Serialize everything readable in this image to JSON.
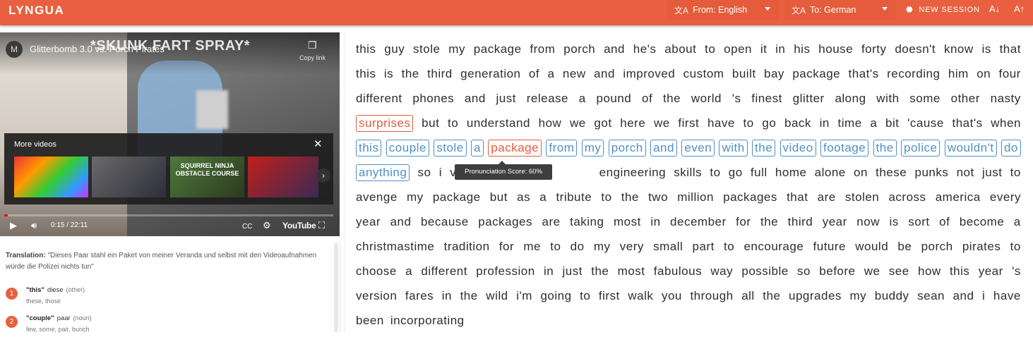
{
  "app": {
    "title": "LYNGUA"
  },
  "header": {
    "from_label": "From: English",
    "to_label": "To: German",
    "new_session_label": "NEW SESSION",
    "font_down_label": "A↓",
    "font_up_label": "A↑",
    "accent_color": "#e8603f"
  },
  "video": {
    "title": "Glitterbomb 3.0 vs. Porch Pirates",
    "overlay_text": "*SKUNK FART SPRAY*",
    "copy_link_label": "Copy link",
    "more_videos_label": "More videos",
    "thumb3_caption": "SQUIRREL NINJA OBSTACLE COURSE",
    "time": "0:15 / 22:11",
    "progress": 0.011,
    "youtube_label": "YouTube"
  },
  "translation_panel": {
    "label": "Translation:",
    "text": "\"Dieses Paar stahl ein Paket von meiner Veranda und selbst mit den Videoaufnahmen würde die Polizei nichts tun\"",
    "words": [
      {
        "num": "1",
        "en": "\"this\"",
        "de": "diese",
        "pos": "(other)",
        "alts": "these, those"
      },
      {
        "num": "2",
        "en": "\"couple\"",
        "de": "paar",
        "pos": "(noun)",
        "alts": "few, some, pair, bunch"
      }
    ]
  },
  "tooltip": {
    "text": "Pronunciation Score: 60%"
  },
  "transcript": {
    "lines": [
      [
        "this",
        "guy",
        "stole",
        "my",
        "package",
        "from",
        "porch",
        "and",
        "he's",
        "about",
        "to",
        "open",
        "it",
        "in",
        "his",
        "house",
        "forty",
        "doesn't",
        "know",
        "is",
        "that"
      ],
      [
        "this",
        "is",
        "the",
        "third",
        "generation",
        "of",
        "a",
        "new",
        "and",
        "improved",
        "custom",
        "built",
        "bay",
        "package",
        "that's",
        "recording",
        "him",
        "on",
        "four"
      ],
      [
        "different",
        "phones",
        "and",
        "just",
        "release",
        "a",
        "pound",
        "of",
        "the",
        "world",
        "'s",
        "finest",
        "glitter",
        "along",
        "with",
        "some",
        "other",
        "nasty"
      ],
      [
        "surprises",
        "but",
        "to",
        "understand",
        "how",
        "we",
        "got",
        "here",
        "we",
        "first",
        "have",
        "to",
        "go",
        "back",
        "in",
        "time",
        "a",
        "bit",
        "'cause",
        "that's",
        "when"
      ],
      [
        "this",
        "couple",
        "stole",
        "a",
        "package",
        "from",
        "my",
        "porch",
        "and",
        "even",
        "with",
        "the",
        "video",
        "footage",
        "the",
        "police",
        "wouldn't",
        "do"
      ],
      [
        "anything",
        "so",
        "i",
        "vo",
        "",
        "engineering",
        "skills",
        "to",
        "go",
        "full",
        "home",
        "alone",
        "on",
        "these",
        "punks",
        "not",
        "just",
        "to"
      ],
      [
        "avenge",
        "my",
        "package",
        "but",
        "as",
        "a",
        "tribute",
        "to",
        "the",
        "two",
        "million",
        "packages",
        "that",
        "are",
        "stolen",
        "across",
        "america",
        "every"
      ],
      [
        "year",
        "and",
        "because",
        "packages",
        "are",
        "taking",
        "most",
        "in",
        "december",
        "for",
        "the",
        "third",
        "year",
        "now",
        "is",
        "sort",
        "of",
        "become",
        "a"
      ],
      [
        "christmastime",
        "tradition",
        "for",
        "me",
        "to",
        "do",
        "my",
        "very",
        "small",
        "part",
        "to",
        "encourage",
        "future",
        "would",
        "be",
        "porch",
        "pirates",
        "to"
      ],
      [
        "choose",
        "a",
        "different",
        "profession",
        "in",
        "just",
        "the",
        "most",
        "fabulous",
        "way",
        "possible",
        "so",
        "before",
        "we",
        "see",
        "how",
        "this",
        "year",
        "'s"
      ],
      [
        "version",
        "fares",
        "in",
        "the",
        "wild",
        "i'm",
        "going",
        "to",
        "first",
        "walk",
        "you",
        "through",
        "all",
        "the",
        "upgrades",
        "my",
        "buddy",
        "sean",
        "and",
        "i",
        "have"
      ],
      [
        "been",
        "incorporating"
      ]
    ],
    "boxed_blue_color": "#4f8fc6",
    "boxed_red_color": "#e35a3c"
  }
}
